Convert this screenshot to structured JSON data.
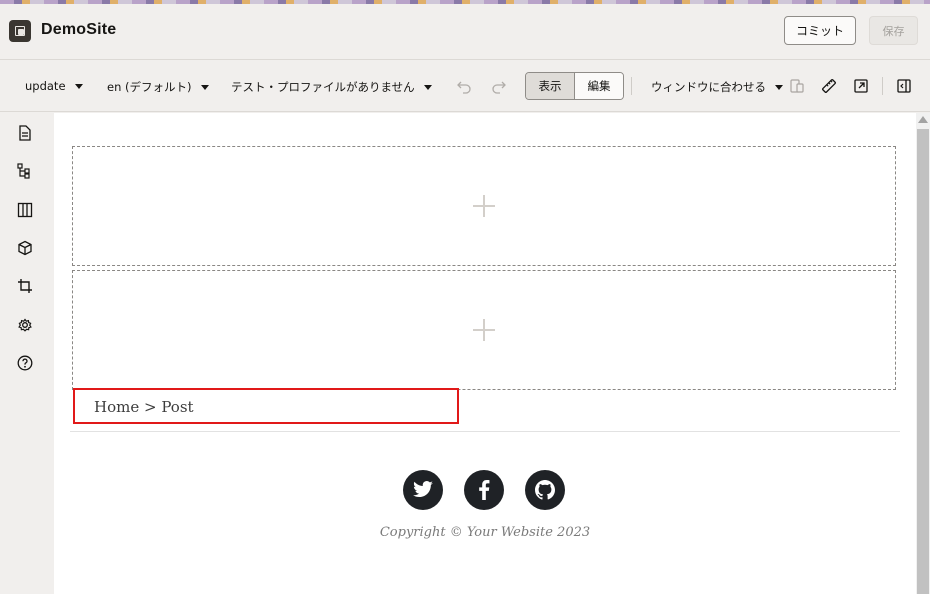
{
  "app": {
    "title": "DemoSite"
  },
  "header": {
    "commit_label": "コミット",
    "save_label": "保存"
  },
  "toolbar": {
    "channel": "update",
    "locale": "en (デフォルト)",
    "profile": "テスト・プロファイルがありません",
    "view_label": "表示",
    "edit_label": "編集",
    "fit": "ウィンドウに合わせる"
  },
  "sidebar": {
    "icons": [
      "pages-icon",
      "components-tree-icon",
      "columns-icon",
      "cube-icon",
      "crop-icon",
      "gear-icon",
      "help-icon"
    ]
  },
  "page": {
    "breadcrumb": "Home > Post",
    "social": [
      "twitter-icon",
      "facebook-icon",
      "github-icon"
    ],
    "copyright": "Copyright © Your Website 2023"
  },
  "colors": {
    "highlight": "#e11919",
    "social_bg": "#1f2226",
    "app_bg": "#f1efed"
  }
}
